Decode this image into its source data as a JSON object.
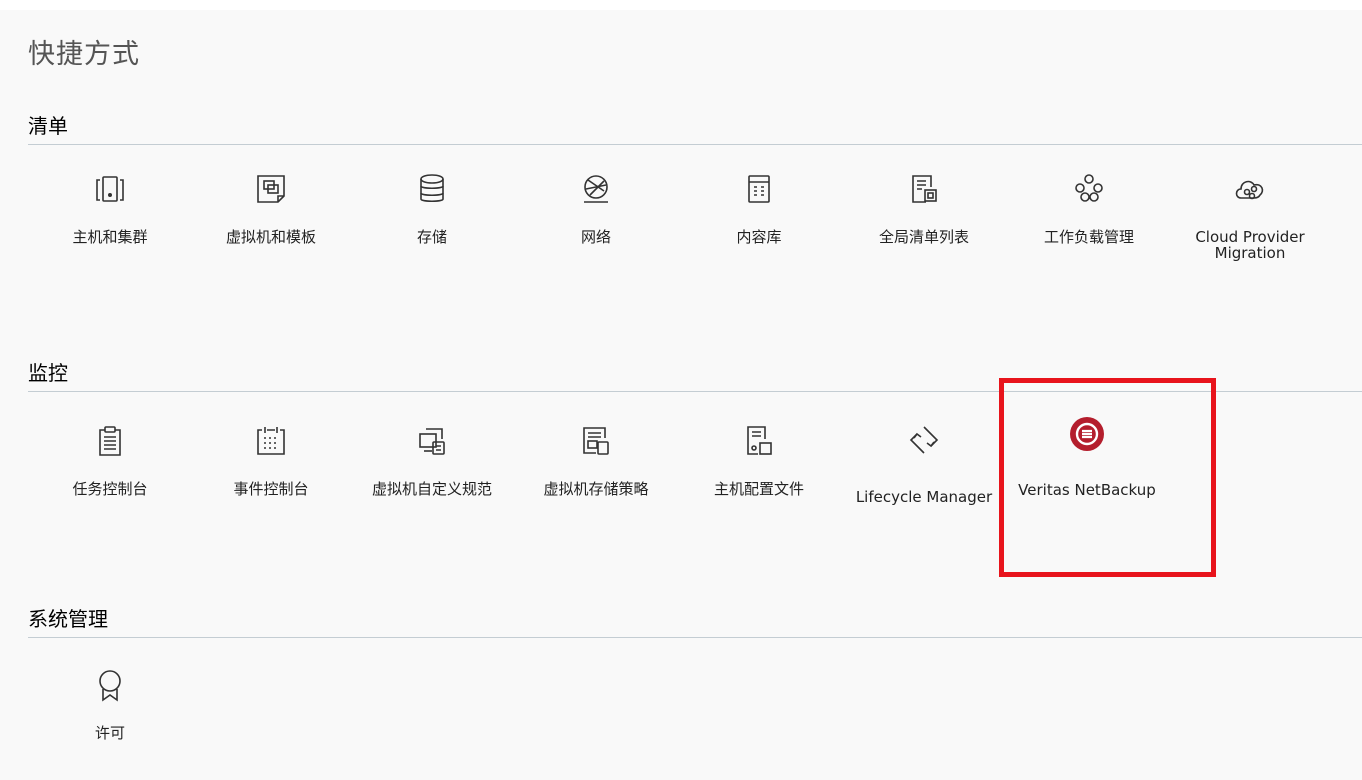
{
  "page": {
    "title": "快捷方式"
  },
  "sections": {
    "inventory": {
      "title": "清单",
      "items": [
        {
          "label": "主机和集群",
          "icon": "hosts-clusters-icon"
        },
        {
          "label": "虚拟机和模板",
          "icon": "vms-templates-icon"
        },
        {
          "label": "存储",
          "icon": "storage-icon"
        },
        {
          "label": "网络",
          "icon": "networking-icon"
        },
        {
          "label": "内容库",
          "icon": "content-library-icon"
        },
        {
          "label": "全局清单列表",
          "icon": "global-inventory-icon"
        },
        {
          "label": "工作负载管理",
          "icon": "workload-management-icon"
        },
        {
          "label": "Cloud Provider Migration",
          "icon": "cloud-migration-icon"
        }
      ]
    },
    "monitoring": {
      "title": "监控",
      "items": [
        {
          "label": "任务控制台",
          "icon": "task-console-icon"
        },
        {
          "label": "事件控制台",
          "icon": "event-console-icon"
        },
        {
          "label": "虚拟机自定义规范",
          "icon": "vm-customization-icon"
        },
        {
          "label": "虚拟机存储策略",
          "icon": "vm-storage-policy-icon"
        },
        {
          "label": "主机配置文件",
          "icon": "host-profiles-icon"
        },
        {
          "label": "Lifecycle Manager",
          "icon": "lifecycle-manager-icon"
        },
        {
          "label": "Veritas NetBackup",
          "icon": "veritas-netbackup-icon"
        }
      ]
    },
    "administration": {
      "title": "系统管理",
      "items": [
        {
          "label": "许可",
          "icon": "licensing-icon"
        }
      ]
    }
  },
  "colors": {
    "icon_stroke": "#333333",
    "brand_red": "#b41e2d",
    "highlight": "#e8141c",
    "divider": "#c4cdd3"
  }
}
